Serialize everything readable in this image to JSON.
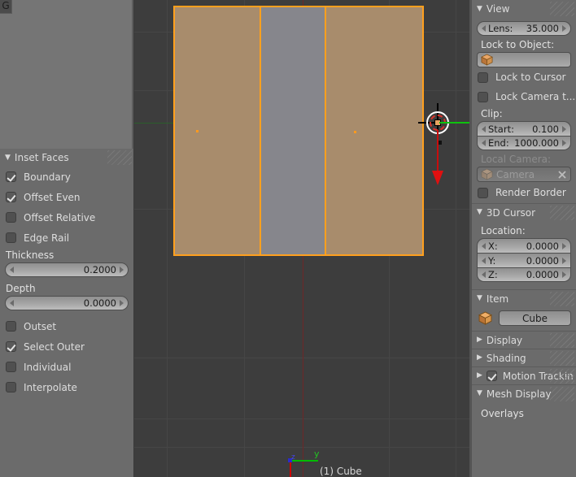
{
  "app": {
    "corner_glyph": "G",
    "viewport_object_label": "(1) Cube",
    "axis_labels": {
      "y": "y",
      "z": "z"
    }
  },
  "tool_panel": {
    "title": "Inset Faces",
    "triangle": "▼",
    "checkboxes": [
      {
        "label": "Boundary",
        "checked": true
      },
      {
        "label": "Offset Even",
        "checked": true
      },
      {
        "label": "Offset Relative",
        "checked": false
      },
      {
        "label": "Edge Rail",
        "checked": false
      }
    ],
    "thickness": {
      "label": "Thickness",
      "value": "0.2000"
    },
    "depth": {
      "label": "Depth",
      "value": "0.0000"
    },
    "checkboxes2": [
      {
        "label": "Outset",
        "checked": false
      },
      {
        "label": "Select Outer",
        "checked": true
      },
      {
        "label": "Individual",
        "checked": false
      },
      {
        "label": "Interpolate",
        "checked": false
      }
    ]
  },
  "properties": {
    "view": {
      "title": "View",
      "triangle": "▼",
      "lens": {
        "label": "Lens:",
        "value": "35.000"
      },
      "lock_to_object_label": "Lock to Object:",
      "lock_to_object_value": "",
      "lock_to_cursor": {
        "label": "Lock to Cursor",
        "checked": false
      },
      "lock_camera": {
        "label": "Lock Camera t...",
        "checked": false
      },
      "clip_label": "Clip:",
      "clip_start": {
        "label": "Start:",
        "value": "0.100"
      },
      "clip_end": {
        "label": "End:",
        "value": "1000.000"
      },
      "local_camera_label": "Local Camera:",
      "local_camera_value": "Camera",
      "render_border": {
        "label": "Render Border",
        "checked": false
      }
    },
    "cursor3d": {
      "title": "3D Cursor",
      "triangle": "▼",
      "location_label": "Location:",
      "fields": [
        {
          "label": "X:",
          "value": "0.0000"
        },
        {
          "label": "Y:",
          "value": "0.0000"
        },
        {
          "label": "Z:",
          "value": "0.0000"
        }
      ]
    },
    "item": {
      "title": "Item",
      "triangle": "▼",
      "object_name": "Cube"
    },
    "display": {
      "title": "Display",
      "triangle": "▶"
    },
    "shading": {
      "title": "Shading",
      "triangle": "▶"
    },
    "motion_tracking": {
      "title": "Motion Trackin",
      "triangle": "▶",
      "checked": true
    },
    "mesh_display": {
      "title": "Mesh Display",
      "triangle": "▼",
      "overlays_label": "Overlays"
    }
  },
  "colors": {
    "panel_bg": "#6b6b6b",
    "viewport_bg": "#3d3d3d",
    "selected_face": "#a88c6c",
    "unselected_face": "#86868c",
    "edge_highlight": "#ffa01e",
    "axis_y_green": "#0ec20e",
    "axis_z_red": "#c80d0d"
  }
}
